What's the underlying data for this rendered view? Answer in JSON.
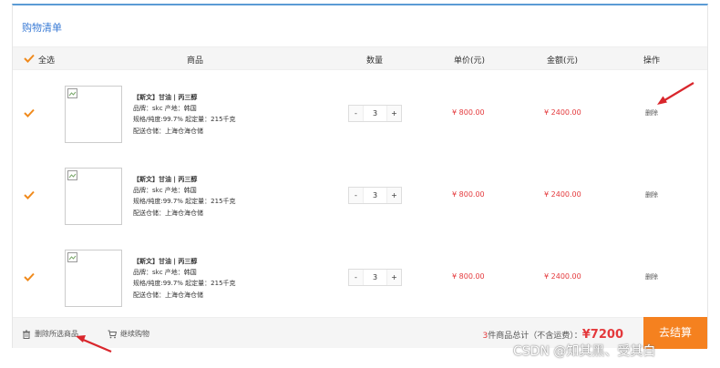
{
  "cart": {
    "title": "购物清单",
    "header": {
      "select_all": "全选",
      "product": "商品",
      "quantity": "数量",
      "unit_price": "单价(元)",
      "amount": "金额(元)",
      "action": "操作"
    },
    "items": [
      {
        "checked": true,
        "name": "【斯文】甘油 | 丙三醇",
        "brand_origin": "品牌：skc 产地：韩国",
        "spec": "规格/纯度:99.7%  起定量：215千克",
        "warehouse": "配送仓储：上海仓海仓储",
        "qty_minus": "-",
        "quantity": "3",
        "qty_plus": "+",
        "unit_price": "¥ 800.00",
        "amount": "¥ 2400.00",
        "delete_label": "删除"
      },
      {
        "checked": true,
        "name": "【斯文】甘油 | 丙三醇",
        "brand_origin": "品牌：skc 产地：韩国",
        "spec": "规格/纯度:99.7%  起定量：215千克",
        "warehouse": "配送仓储：上海仓海仓储",
        "qty_minus": "-",
        "quantity": "3",
        "qty_plus": "+",
        "unit_price": "¥ 800.00",
        "amount": "¥ 2400.00",
        "delete_label": "删除"
      },
      {
        "checked": true,
        "name": "【斯文】甘油 | 丙三醇",
        "brand_origin": "品牌：skc 产地：韩国",
        "spec": "规格/纯度:99.7%  起定量：215千克",
        "warehouse": "配送仓储：上海仓海仓储",
        "qty_minus": "-",
        "quantity": "3",
        "qty_plus": "+",
        "unit_price": "¥ 800.00",
        "amount": "¥ 2400.00",
        "delete_label": "删除"
      }
    ],
    "footer": {
      "delete_selected": "删除所选商品",
      "continue_shopping": "继续购物",
      "count": "3",
      "summary_text": "件商品总计（不含运费）：",
      "total": "¥7200",
      "checkout": "去结算"
    }
  },
  "icons": {
    "check": "check-icon",
    "trash": "trash-icon",
    "cart": "cart-icon",
    "broken_image": "broken-image-icon",
    "arrow": "arrow-icon"
  },
  "colors": {
    "accent_blue": "#3a7bd5",
    "price_red": "#e4393c",
    "checkout_orange": "#f5811f",
    "check_orange": "#f08a1c",
    "arrow_red": "#d9262c"
  },
  "watermark": "CSDN @知其黑、受其白"
}
